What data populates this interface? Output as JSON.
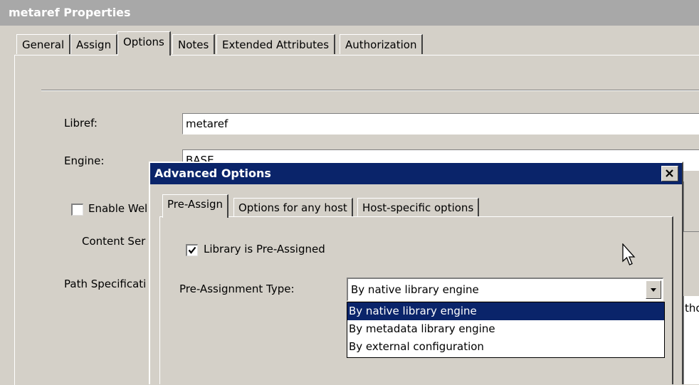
{
  "window": {
    "title": "metaref Properties"
  },
  "tabs": [
    {
      "label": "General"
    },
    {
      "label": "Assign"
    },
    {
      "label": "Options"
    },
    {
      "label": "Notes"
    },
    {
      "label": "Extended Attributes"
    },
    {
      "label": "Authorization"
    }
  ],
  "form": {
    "libref_label": "Libref:",
    "libref_value": "metaref",
    "engine_label": "Engine:",
    "engine_value": "BASE",
    "enable_label": "Enable Wel",
    "content_label": "Content Ser",
    "path_label": "Path Specificati",
    "right_fragment": "tho"
  },
  "dialog": {
    "title": "Advanced Options",
    "tabs": [
      {
        "label": "Pre-Assign"
      },
      {
        "label": "Options for any host"
      },
      {
        "label": "Host-specific options"
      }
    ],
    "preassigned_label": "Library is Pre-Assigned",
    "preassigned_checked": true,
    "type_label": "Pre-Assignment Type:",
    "type_selected": "By native library engine",
    "options": [
      "By native library engine",
      "By metadata library engine",
      "By external configuration"
    ]
  },
  "colors": {
    "title_active": "#0a246a",
    "title_inactive": "#a8a8a8",
    "face": "#d4d0c8"
  }
}
